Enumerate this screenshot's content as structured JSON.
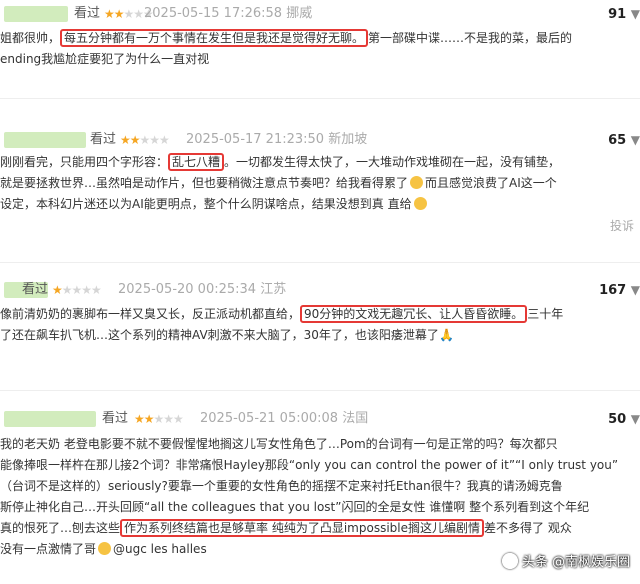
{
  "common": {
    "seen": "看过",
    "report": "投诉",
    "caret": "▼"
  },
  "reviews": [
    {
      "stars": "★★",
      "stars_off": "★★★",
      "ts": "2025-05-15 17:26:58 挪威",
      "votes": "91",
      "lines": [
        {
          "pre": "姐都很帅，",
          "hl": "每五分钟都有一万个事情在发生但是我还是觉得好无聊。",
          "post": "第一部碟中谍……不是我的菜，最后的"
        },
        {
          "pre": "ending我尴尬症要犯了为什么一直对视"
        }
      ]
    },
    {
      "stars": "★★",
      "stars_off": "★★★",
      "ts": "2025-05-17 21:23:50 新加坡",
      "votes": "65",
      "lines": [
        {
          "pre": "刚刚看完，只能用四个字形容：",
          "hl": "乱七八糟",
          "post": "。一切都发生得太快了，一大堆动作戏堆砌在一起，没有铺垫，"
        },
        {
          "pre": "就是要拯救世界…虽然咱是动作片，但也要稍微注意点节奏吧？给我看得累了",
          "post": "而且感觉浪费了AI这一个"
        },
        {
          "pre": "设定，本科幻片迷还以为AI能更明点，整个什么阴谋啥点，结果没想到真 直给"
        }
      ]
    },
    {
      "stars": "★",
      "stars_off": "★★★★",
      "ts": "2025-05-20 00:25:34 江苏",
      "votes": "167",
      "lines": [
        {
          "pre": "像前清奶奶的裹脚布一样又臭又长，反正派动机都直给，",
          "hl": "90分钟的文戏无趣冗长、让人昏昏欲睡。",
          "post": "三十年"
        },
        {
          "pre": "了还在飙车扒飞机…这个系列的精神AV刺激不来大脑了，30年了，也该阳痿泄幕了"
        }
      ]
    },
    {
      "stars": "★★",
      "stars_off": "★★★",
      "ts": "2025-05-21 05:00:08 法国",
      "votes": "50",
      "lines": [
        {
          "pre": "我的老天奶 老登电影要不就不要假惺惺地搁这儿写女性角色了…Pom的台词有一句是正常的吗？每次都只"
        },
        {
          "pre": "能像捧哏一样杵在那儿接2个词？非常痛恨Hayley那段“only you can control the power of it”“I only trust you”"
        },
        {
          "pre": "（台词不是这样的）seriously?要靠一个重要的女性角色的摇摆不定来衬托Ethan很牛？我真的请汤姆克鲁"
        },
        {
          "pre": "斯停止神化自己…开头回顾“all the colleagues that you lost”闪回的全是女性 谁懂啊 整个系列看到这个年纪"
        },
        {
          "pre": "真的恨死了…刨去这些",
          "hl": "作为系列终结篇也是够草率 纯纯为了凸显impossible搁这儿编剧情",
          "post": "差不多得了 观众"
        },
        {
          "pre": "没有一点激情了哥",
          "post": "@ugc les halles"
        }
      ]
    }
  ],
  "watermark": {
    "text": "头条 @南枫娱乐圈"
  }
}
